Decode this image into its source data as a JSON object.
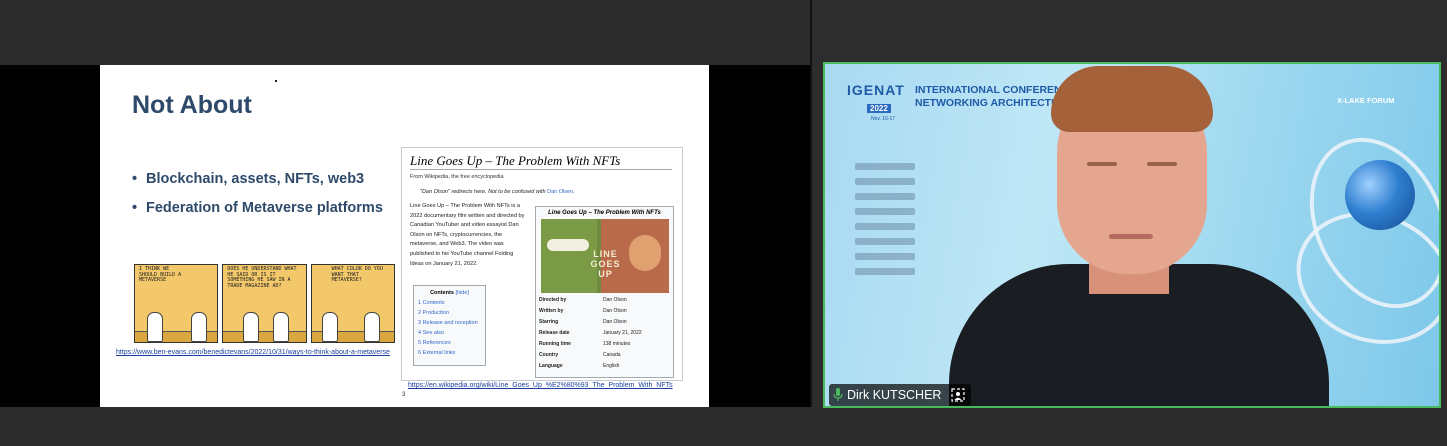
{
  "slide": {
    "title": "Not About",
    "bullets": [
      "Blockchain, assets, NFTs, web3",
      "Federation of Metaverse platforms"
    ],
    "comic_bubbles": [
      "I THINK WE SHOULD BUILD A METAVERSE",
      "DOES HE UNDERSTAND WHAT HE SAID OR IS IT SOMETHING HE SAW IN A TRADE MAGAZINE AD?",
      "WHAT COLOR DO YOU WANT THAT METAVERSE?"
    ],
    "comic_url": "https://www.ben-evans.com/benedictevans/2022/10/31/ways-to-think-about-a-metaverse",
    "wiki_url": "https://en.wikipedia.org/wiki/Line_Goes_Up_%E2%80%93_The_Problem_With_NFTs",
    "page_number": "3"
  },
  "wiki": {
    "title": "Line Goes Up – The Problem With NFTs",
    "tagline": "From Wikipedia, the free encyclopedia",
    "hatnote_prefix": "\"Dan Olson\" redirects here. Not to be confused with",
    "hatnote_link": "Dan Olsen",
    "body": "Line Goes Up – The Problem With NFTs is a 2022 documentary film written and directed by Canadian YouTuber and video essayist Dan Olson on NFTs, cryptocurrencies, the metaverse, and Web3. The video was published to his YouTube channel Folding Ideas on January 21, 2022.",
    "toc_label": "Contents",
    "toc_hide": "[hide]",
    "toc": [
      "1 Contents",
      "2 Production",
      "3 Release and reception",
      "4 See also",
      "5 References",
      "6 External links"
    ],
    "infobox_title": "Line Goes Up – The Problem With NFTs",
    "poster_text": "LINE GOES UP",
    "infobox": [
      {
        "k": "Directed by",
        "v": "Dan Olson"
      },
      {
        "k": "Written by",
        "v": "Dan Olson"
      },
      {
        "k": "Starring",
        "v": "Dan Olson"
      },
      {
        "k": "Release date",
        "v": "January 21, 2022"
      },
      {
        "k": "Running time",
        "v": "138 minutes"
      },
      {
        "k": "Country",
        "v": "Canada"
      },
      {
        "k": "Language",
        "v": "English"
      }
    ]
  },
  "video": {
    "conf_logo": "IGENAT",
    "conf_year": "2022",
    "conf_dates": "Nov. 16-17",
    "conf_title_1": "INTERNATIONAL CONFERENCE",
    "conf_title_2": "NETWORKING ARCHITECTURE",
    "forum": "X-LAKE FORUM",
    "participant_name": "Dirk KUTSCHER"
  },
  "colors": {
    "active_speaker_border": "#4aba5e",
    "slide_heading": "#2e4a6b",
    "wiki_link": "#3366cc"
  }
}
